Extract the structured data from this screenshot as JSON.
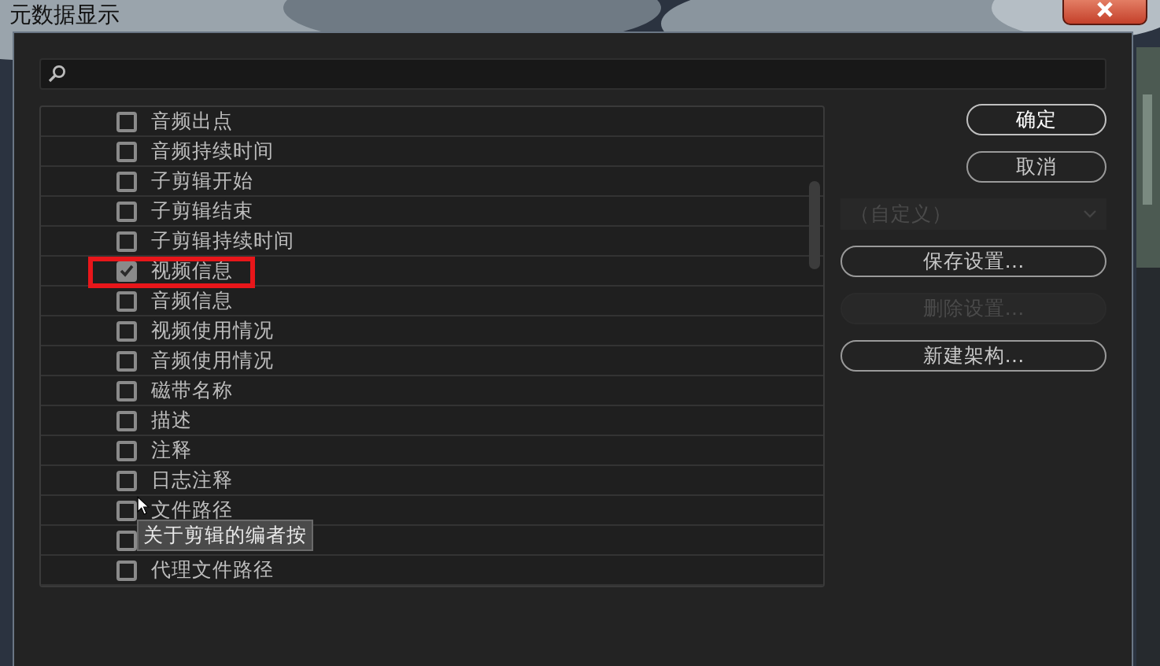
{
  "window": {
    "title": "元数据显示"
  },
  "fields": [
    {
      "label": "音频出点",
      "checked": false,
      "highlighted": false
    },
    {
      "label": "音频持续时间",
      "checked": false,
      "highlighted": false
    },
    {
      "label": "子剪辑开始",
      "checked": false,
      "highlighted": false
    },
    {
      "label": "子剪辑结束",
      "checked": false,
      "highlighted": false
    },
    {
      "label": "子剪辑持续时间",
      "checked": false,
      "highlighted": false
    },
    {
      "label": "视频信息",
      "checked": true,
      "highlighted": true
    },
    {
      "label": "音频信息",
      "checked": false,
      "highlighted": false
    },
    {
      "label": "视频使用情况",
      "checked": false,
      "highlighted": false
    },
    {
      "label": "音频使用情况",
      "checked": false,
      "highlighted": false
    },
    {
      "label": "磁带名称",
      "checked": false,
      "highlighted": false
    },
    {
      "label": "描述",
      "checked": false,
      "highlighted": false
    },
    {
      "label": "注释",
      "checked": false,
      "highlighted": false
    },
    {
      "label": "日志注释",
      "checked": false,
      "highlighted": false
    },
    {
      "label": "文件路径",
      "checked": false,
      "highlighted": false
    },
    {
      "checked": false,
      "highlighted": false
    },
    {
      "label": "代理文件路径",
      "checked": false,
      "highlighted": false
    }
  ],
  "tooltip": {
    "text": "关于剪辑的编者按"
  },
  "buttons": [
    {
      "kind": "button",
      "label": "确定",
      "disabled": false,
      "primary": true
    },
    {
      "kind": "button",
      "label": "取消",
      "disabled": false,
      "primary": false
    },
    {
      "kind": "dropdown",
      "label": "（自定义）",
      "disabled": true,
      "primary": false
    },
    {
      "kind": "button",
      "label": "保存设置…",
      "disabled": false,
      "primary": false
    },
    {
      "kind": "button",
      "label": "删除设置…",
      "disabled": true,
      "primary": false
    },
    {
      "kind": "button",
      "label": "新建架构…",
      "disabled": false,
      "primary": false
    }
  ]
}
